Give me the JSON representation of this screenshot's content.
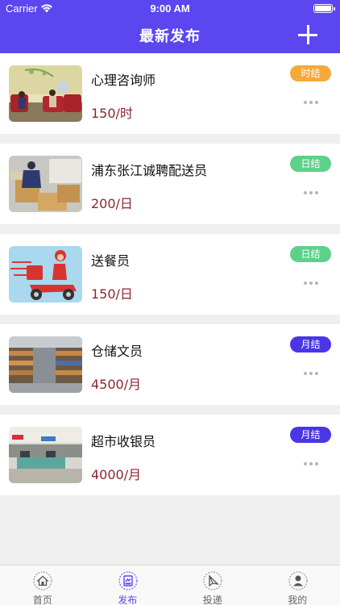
{
  "status_bar": {
    "carrier": "Carrier",
    "time": "9:00 AM"
  },
  "nav": {
    "title": "最新发布",
    "add_icon": "plus-icon"
  },
  "colors": {
    "primary": "#5b46f0",
    "pay_text": "#8b2630",
    "badge_hourly": "#f5a93b",
    "badge_daily": "#5ed08a",
    "badge_monthly": "#4a36e6"
  },
  "jobs": [
    {
      "title": "心理咨询师",
      "pay": "150/时",
      "badge": "时结",
      "badge_type": "hourly",
      "image": "counseling-room-photo"
    },
    {
      "title": "浦东张江诚聘配送员",
      "pay": "200/日",
      "badge": "日结",
      "badge_type": "daily",
      "image": "delivery-worker-photo"
    },
    {
      "title": "送餐员",
      "pay": "150/日",
      "badge": "日结",
      "badge_type": "daily",
      "image": "scooter-delivery-illustration"
    },
    {
      "title": "仓储文员",
      "pay": "4500/月",
      "badge": "月结",
      "badge_type": "monthly",
      "image": "warehouse-photo"
    },
    {
      "title": "超市收银员",
      "pay": "4000/月",
      "badge": "月结",
      "badge_type": "monthly",
      "image": "supermarket-photo"
    }
  ],
  "tabs": [
    {
      "label": "首页",
      "icon": "home-icon",
      "active": false
    },
    {
      "label": "发布",
      "icon": "publish-icon",
      "active": true
    },
    {
      "label": "投递",
      "icon": "send-icon",
      "active": false
    },
    {
      "label": "我的",
      "icon": "profile-icon",
      "active": false
    }
  ]
}
